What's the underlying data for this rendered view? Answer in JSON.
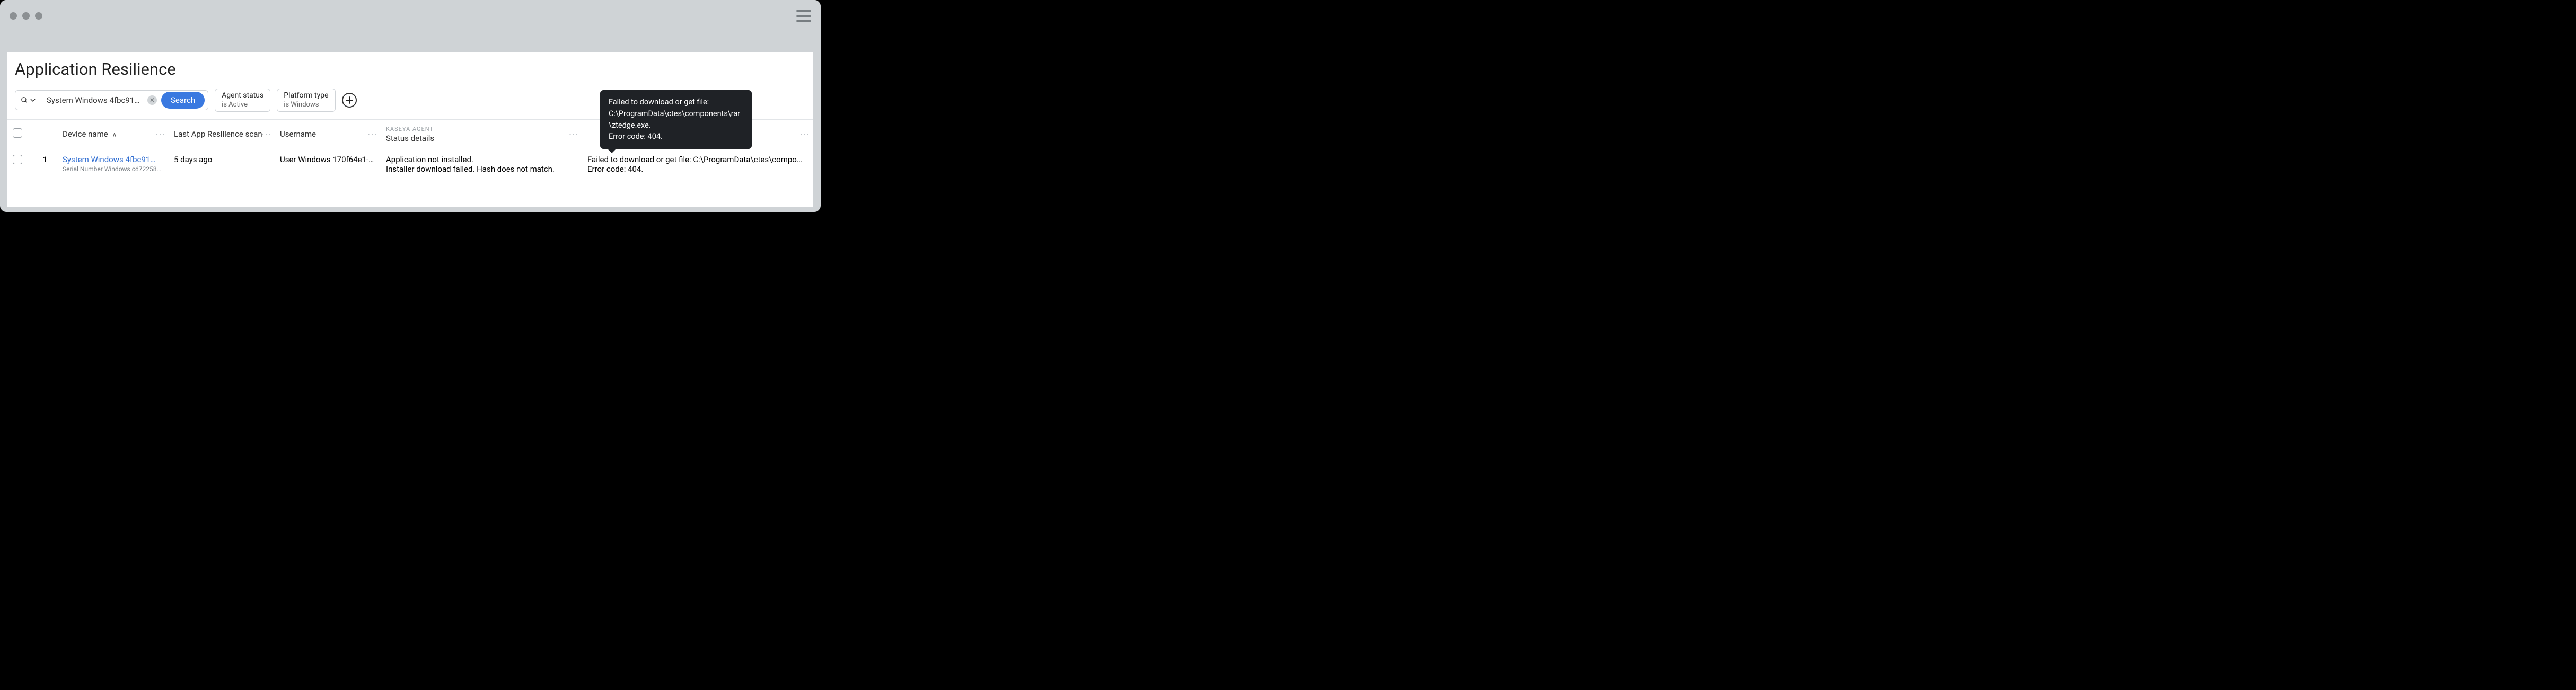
{
  "page": {
    "title": "Application Resilience"
  },
  "search": {
    "value": "System Windows 4fbc910c…",
    "button_label": "Search"
  },
  "filters": {
    "agent_status": {
      "label": "Agent status",
      "sub": "is Active"
    },
    "platform_type": {
      "label": "Platform type",
      "sub": "is Windows"
    }
  },
  "columns": {
    "device_name": "Device name",
    "last_scan": "Last App Resilience scan",
    "username": "Username",
    "status_group": "KASEYA AGENT",
    "status_details": "Status details",
    "last_hidden": ""
  },
  "rows": [
    {
      "index": "1",
      "device_name": "System Windows 4fbc91…",
      "device_sub": "Serial Number Windows cd722584-1…",
      "last_scan": "5 days ago",
      "username": "User Windows 170f64e1-…",
      "status_details": "Application not installed.\nInstaller download failed. Hash does not match.",
      "error_short": "Failed to download or get file: C:\\ProgramData\\ctes\\compo…",
      "error_code_line": "Error code: 404."
    }
  ],
  "tooltip": {
    "line1": "Failed to download or get file:",
    "line2": "C:\\ProgramData\\ctes\\components\\rar\\ztedge.exe.",
    "line3": "Error code: 404."
  }
}
